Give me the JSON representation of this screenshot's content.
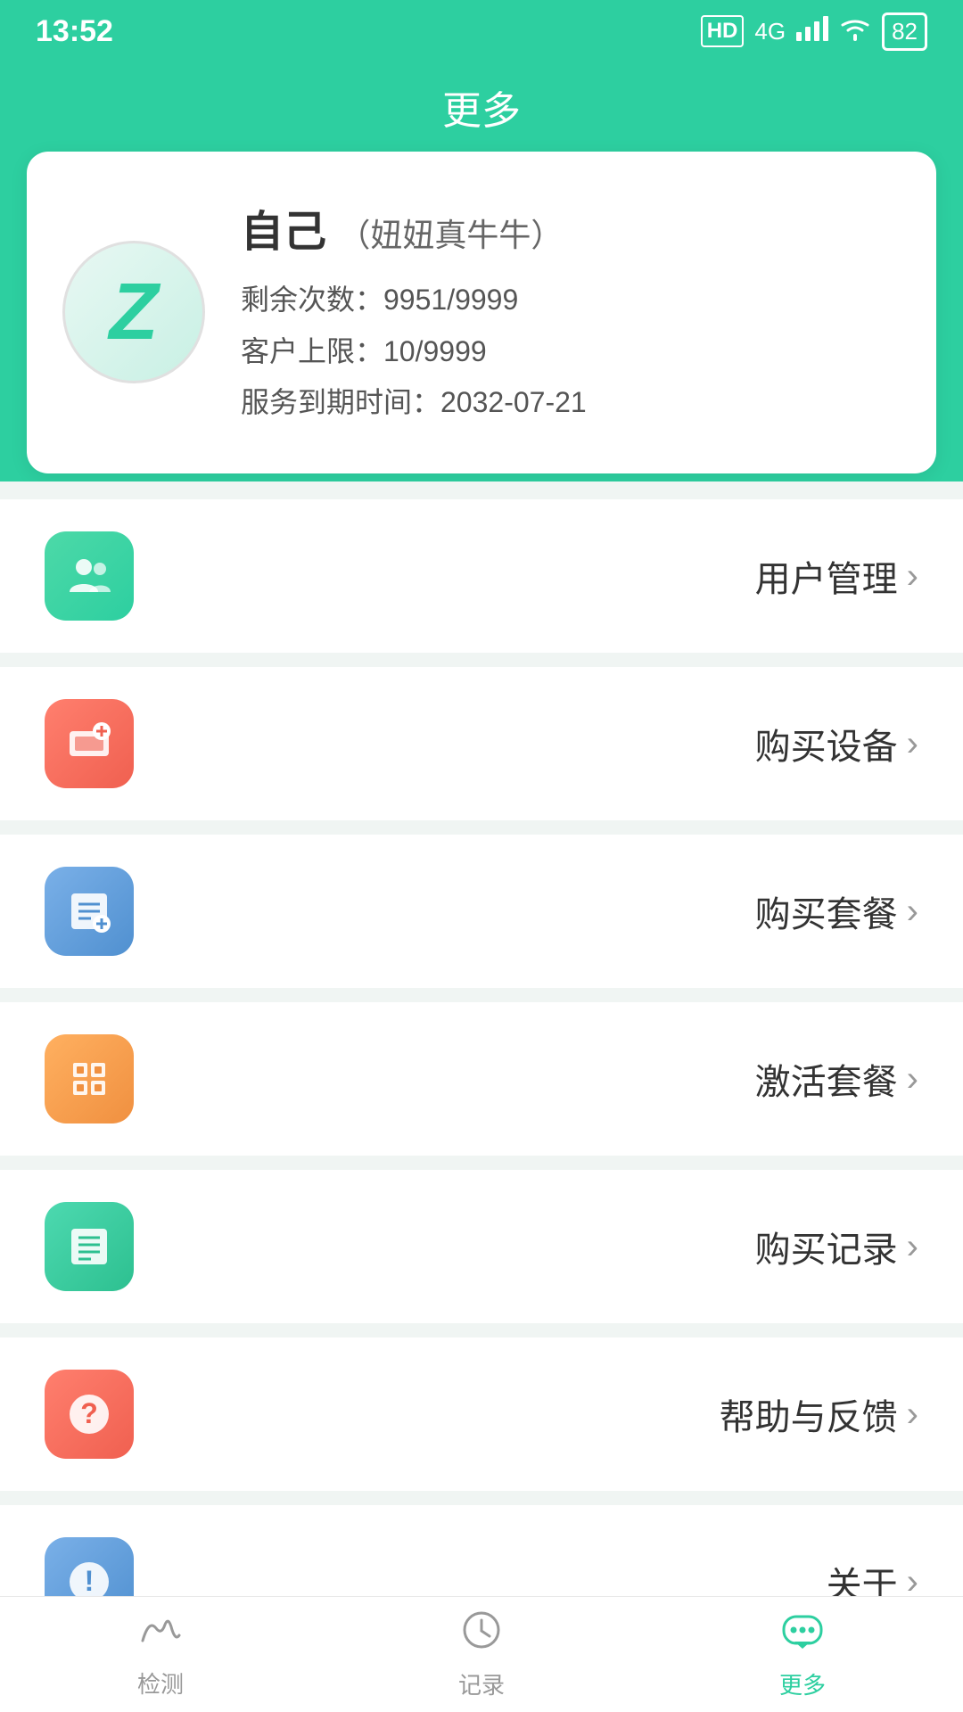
{
  "statusBar": {
    "time": "13:52",
    "batteryLevel": "82"
  },
  "header": {
    "title": "更多"
  },
  "profile": {
    "avatarLetter": "Z",
    "name": "自己",
    "nickname": "（妞妞真牛牛）",
    "remainingCount": "剩余次数：9951/9999",
    "clientLimit": "客户上限：10/9999",
    "expireDate": "服务到期时间：2032-07-21"
  },
  "menuItems": [
    {
      "id": "user-management",
      "label": "用户管理",
      "iconType": "green",
      "iconSymbol": "user"
    },
    {
      "id": "buy-device",
      "label": "购买设备",
      "iconType": "red",
      "iconSymbol": "device"
    },
    {
      "id": "buy-plan",
      "label": "购买套餐",
      "iconType": "blue",
      "iconSymbol": "plan"
    },
    {
      "id": "activate-plan",
      "label": "激活套餐",
      "iconType": "orange",
      "iconSymbol": "activate"
    },
    {
      "id": "purchase-record",
      "label": "购买记录",
      "iconType": "teal",
      "iconSymbol": "record"
    },
    {
      "id": "help-feedback",
      "label": "帮助与反馈",
      "iconType": "red",
      "iconSymbol": "help"
    },
    {
      "id": "about",
      "label": "关于",
      "iconType": "blue-solid",
      "iconSymbol": "about"
    }
  ],
  "tabBar": {
    "tabs": [
      {
        "id": "detect",
        "label": "检测",
        "active": false
      },
      {
        "id": "record",
        "label": "记录",
        "active": false
      },
      {
        "id": "more",
        "label": "更多",
        "active": true
      }
    ]
  }
}
